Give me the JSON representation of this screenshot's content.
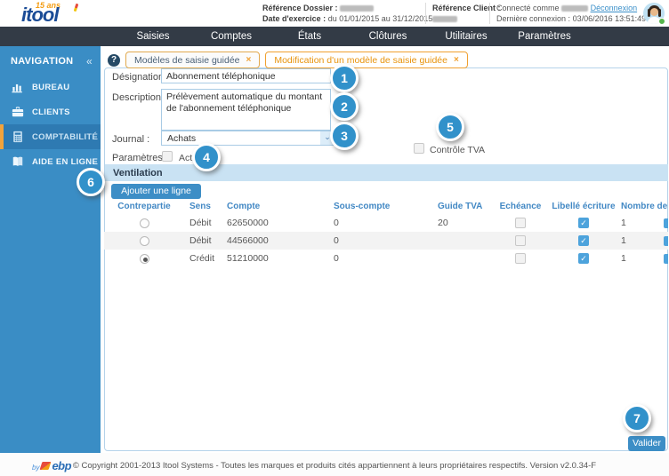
{
  "header": {
    "logo": {
      "badge": "15 ans",
      "name": "itool"
    },
    "dossier": {
      "label": "Référence Dossier :",
      "date_label": "Date d'exercice :",
      "date_value": "du 01/01/2015 au 31/12/2015"
    },
    "client": {
      "label": "Référence Client :"
    },
    "session": {
      "connected_prefix": "Connecté comme",
      "logout_label": "Déconnexion",
      "last_label": "Dernière connexion :",
      "last_value": "03/06/2016 13:51:49"
    }
  },
  "menubar": {
    "items": [
      "Saisies",
      "Comptes",
      "États",
      "Clôtures",
      "Utilitaires",
      "Paramètres"
    ]
  },
  "sidebar": {
    "title": "NAVIGATION",
    "items": [
      {
        "label": "BUREAU",
        "icon": "chart-icon",
        "active": false
      },
      {
        "label": "CLIENTS",
        "icon": "briefcase-icon",
        "active": false
      },
      {
        "label": "COMPTABILITÉ",
        "icon": "calculator-icon",
        "active": true
      },
      {
        "label": "AIDE EN LIGNE",
        "icon": "book-icon",
        "active": false
      }
    ]
  },
  "tabs": [
    {
      "label": "Modèles de saisie guidée",
      "active": false
    },
    {
      "label": "Modification d'un modèle de saisie guidée",
      "active": true
    }
  ],
  "icons": {
    "close": "×",
    "help": "?",
    "select_chevron": "⌄",
    "collapse": "«"
  },
  "form": {
    "designation": {
      "label": "Désignation :",
      "value": "Abonnement téléphonique"
    },
    "description": {
      "label": "Description :",
      "value": "Prélèvement automatique du montant de l'abonnement téléphonique"
    },
    "journal": {
      "label": "Journal :",
      "value": "Achats"
    },
    "parametres": {
      "label": "Paramètres :",
      "actif_label": "Actif",
      "actif_checked": false
    },
    "controle_tva": {
      "label": "Contrôle TVA",
      "checked": false
    }
  },
  "ventilation": {
    "title": "Ventilation",
    "add_button_label": "Ajouter une ligne",
    "columns": [
      "Contrepartie",
      "Sens",
      "Compte",
      "Sous-compte",
      "Guide TVA",
      "Echéance",
      "Libellé écriture",
      "Nombre de ligne"
    ],
    "rows": [
      {
        "contrepartie_selected": false,
        "sens": "Débit",
        "compte": "62650000",
        "sous_compte": "0",
        "guide_tva": "20",
        "echeance_checked": false,
        "libelle_checked": true,
        "check_glyph": "✓",
        "nombre": "1"
      },
      {
        "contrepartie_selected": false,
        "sens": "Débit",
        "compte": "44566000",
        "sous_compte": "0",
        "guide_tva": "",
        "echeance_checked": false,
        "libelle_checked": true,
        "check_glyph": "✓",
        "nombre": "1"
      },
      {
        "contrepartie_selected": true,
        "sens": "Crédit",
        "compte": "51210000",
        "sous_compte": "0",
        "guide_tva": "",
        "echeance_checked": false,
        "libelle_checked": true,
        "check_glyph": "✓",
        "nombre": "1"
      }
    ]
  },
  "callouts": [
    "1",
    "2",
    "3",
    "4",
    "5",
    "6",
    "7"
  ],
  "actions": {
    "valider_label": "Valider"
  },
  "footer": {
    "by_label": "by",
    "brand": "ebp",
    "copyright": "© Copyright 2001-2013 Itool Systems - Toutes les marques et produits cités appartiennent à leurs propriétaires respectifs. Version v2.0.34-F"
  },
  "colors": {
    "sidebar_blue": "#3a8dc5",
    "sidebar_active": "#2e7ab2",
    "accent_orange": "#f2a33c",
    "nav_dark": "#333b46",
    "callout_blue": "#3191ca",
    "ventilation_bar": "#c9e2f3",
    "link_blue": "#3a8fc9",
    "checkbox_checked": "#4da3dc",
    "tab_active_text": "#e8930c"
  }
}
